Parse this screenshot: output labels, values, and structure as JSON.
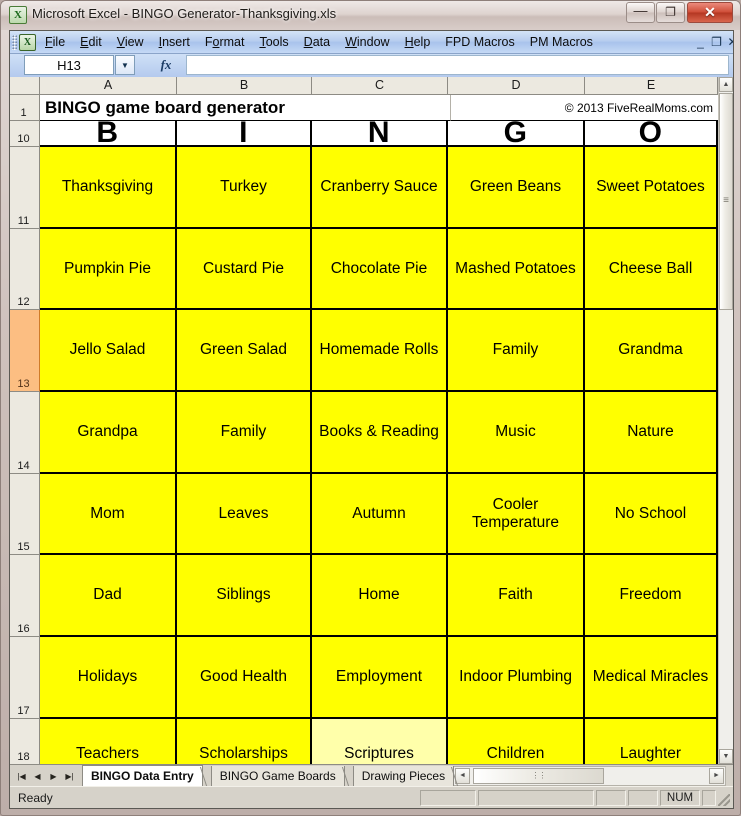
{
  "window": {
    "title": "Microsoft Excel - BINGO Generator-Thanksgiving.xls",
    "app_icon": "excel-icon",
    "minimize_glyph": "—",
    "maximize_glyph": "❐",
    "close_glyph": "✕"
  },
  "menubar": {
    "items": [
      {
        "label": "File",
        "accel": "F"
      },
      {
        "label": "Edit",
        "accel": "E"
      },
      {
        "label": "View",
        "accel": "V"
      },
      {
        "label": "Insert",
        "accel": "I"
      },
      {
        "label": "Format",
        "accel": "o"
      },
      {
        "label": "Tools",
        "accel": "T"
      },
      {
        "label": "Data",
        "accel": "D"
      },
      {
        "label": "Window",
        "accel": "W"
      },
      {
        "label": "Help",
        "accel": "H"
      },
      {
        "label": "FPD Macros",
        "accel": ""
      },
      {
        "label": "PM Macros",
        "accel": ""
      }
    ],
    "mdi_minimize": "_",
    "mdi_restore": "❐",
    "mdi_close": "✕"
  },
  "formula_bar": {
    "name_box_value": "H13",
    "name_box_arrow": "▼",
    "fx_label": "fx",
    "formula_value": ""
  },
  "grid": {
    "column_headers": [
      "A",
      "B",
      "C",
      "D",
      "E"
    ],
    "row_headers": [
      "1",
      "10",
      "11",
      "12",
      "13",
      "14",
      "15",
      "16",
      "17"
    ],
    "active_row": "13",
    "title_cell": "BINGO game board generator",
    "copyright_cell": "© 2013 FiveRealMoms.com",
    "bingo_header": [
      "B",
      "I",
      "N",
      "G",
      "O"
    ],
    "rows": [
      {
        "row": "11",
        "cells": [
          "Thanksgiving",
          "Turkey",
          "Cranberry Sauce",
          "Green Beans",
          "Sweet Potatoes"
        ]
      },
      {
        "row": "12",
        "cells": [
          "Pumpkin Pie",
          "Custard Pie",
          "Chocolate Pie",
          "Mashed Potatoes",
          "Cheese Ball"
        ]
      },
      {
        "row": "13",
        "cells": [
          "Jello Salad",
          "Green Salad",
          "Homemade Rolls",
          "Family",
          "Grandma"
        ]
      },
      {
        "row": "14",
        "cells": [
          "Grandpa",
          "Family",
          "Books & Reading",
          "Music",
          "Nature"
        ]
      },
      {
        "row": "15",
        "cells": [
          "Mom",
          "Leaves",
          "Autumn",
          "Cooler Temperature",
          "No School"
        ]
      },
      {
        "row": "16",
        "cells": [
          "Dad",
          "Siblings",
          "Home",
          "Faith",
          "Freedom"
        ]
      },
      {
        "row": "17",
        "cells": [
          "Holidays",
          "Good Health",
          "Employment",
          "Indoor Plumbing",
          "Medical Miracles"
        ]
      },
      {
        "row": "18",
        "cells": [
          "Teachers",
          "Scholarships",
          "Scriptures",
          "Children",
          "Laughter"
        ]
      }
    ],
    "cell_fill": "#FFFF00",
    "cell_fill_alt": "#FFFFAA",
    "active_row_header_fill": "#FCBE82"
  },
  "scrollbar": {
    "up_glyph": "▲",
    "down_glyph": "▼",
    "left_glyph": "◄",
    "right_glyph": "►"
  },
  "sheet_tabs": {
    "nav_first": "|◀",
    "nav_prev": "◀",
    "nav_next": "▶",
    "nav_last": "▶|",
    "tabs": [
      {
        "label": "BINGO Data Entry",
        "active": true
      },
      {
        "label": "BINGO Game Boards",
        "active": false
      },
      {
        "label": "Drawing Pieces",
        "active": false
      }
    ]
  },
  "status_bar": {
    "mode": "Ready",
    "num_lock": "NUM"
  }
}
